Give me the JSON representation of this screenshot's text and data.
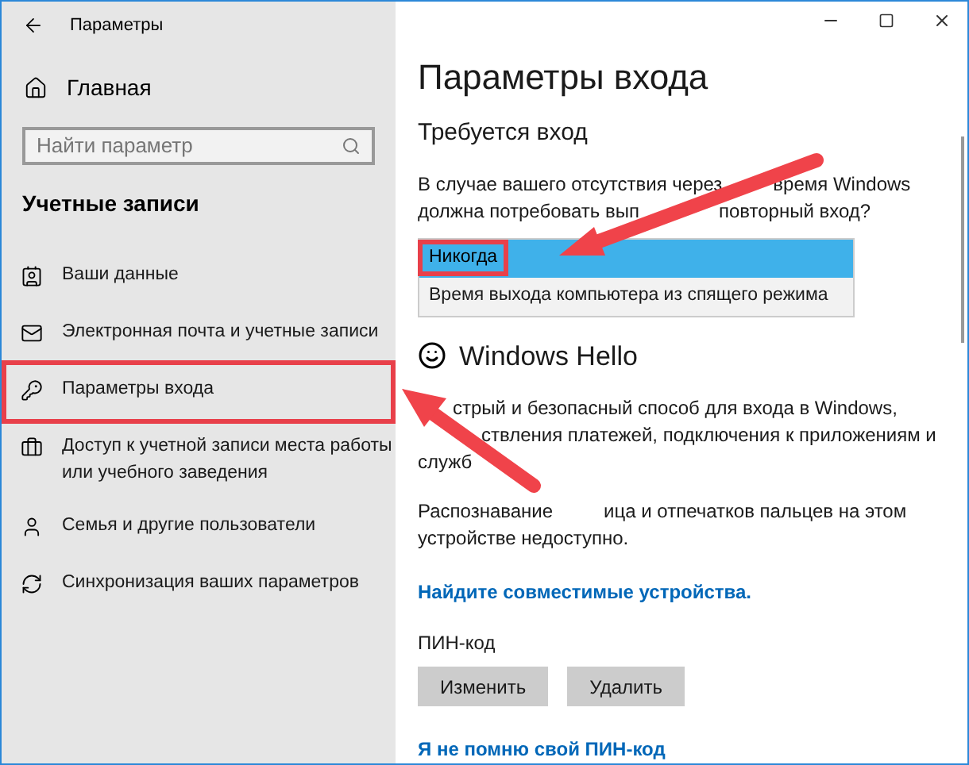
{
  "window": {
    "title": "Параметры"
  },
  "sidebar": {
    "home": "Главная",
    "search": {
      "placeholder": "Найти параметр"
    },
    "section": "Учетные записи",
    "items": [
      {
        "lines": [
          "Ваши данные"
        ],
        "highlighted": false
      },
      {
        "lines": [
          "Электронная почта и учетные записи"
        ],
        "highlighted": false
      },
      {
        "lines": [
          "Параметры входа"
        ],
        "highlighted": true
      },
      {
        "lines": [
          "Доступ к учетной записи места работы",
          "или учебного заведения"
        ],
        "highlighted": false
      },
      {
        "lines": [
          "Семья и другие пользователи"
        ],
        "highlighted": false
      },
      {
        "lines": [
          "Синхронизация ваших параметров"
        ],
        "highlighted": false
      }
    ]
  },
  "page": {
    "title": "Параметры входа",
    "section": "Требуется вход",
    "question": [
      {
        "covered_start": false,
        "segments": [
          "В случае вашего отсутствия через",
          "время Windows"
        ]
      },
      {
        "covered_start": false,
        "segments": [
          "должна потребовать вып",
          "повторный вход?"
        ]
      }
    ],
    "options": [
      {
        "label": "Никогда",
        "selected": true,
        "highlighted": true
      },
      {
        "label": "Время выхода компьютера из спящего режима",
        "selected": false,
        "highlighted": false
      }
    ],
    "hello_title": "Windows Hello",
    "hello_text": [
      {
        "covered_start": true,
        "segments": [
          "стрый и безопасный способ для входа в Windows,"
        ]
      },
      {
        "covered_start": true,
        "segments": [
          "ствления платежей, подключения к приложениям и"
        ]
      },
      {
        "covered_start": false,
        "segments": [
          "служб"
        ]
      }
    ],
    "face_text": [
      {
        "covered_start": false,
        "segments": [
          "Распознавание",
          "ица и отпечатков пальцев на этом"
        ]
      },
      {
        "covered_start": false,
        "segments": [
          "устройстве недоступно."
        ]
      }
    ],
    "devices_link": "Найдите совместимые устройства.",
    "pin_label": "ПИН-код",
    "pin_buttons": [
      "Изменить",
      "Удалить"
    ],
    "forgot_link": "Я не помню свой ПИН-код"
  }
}
